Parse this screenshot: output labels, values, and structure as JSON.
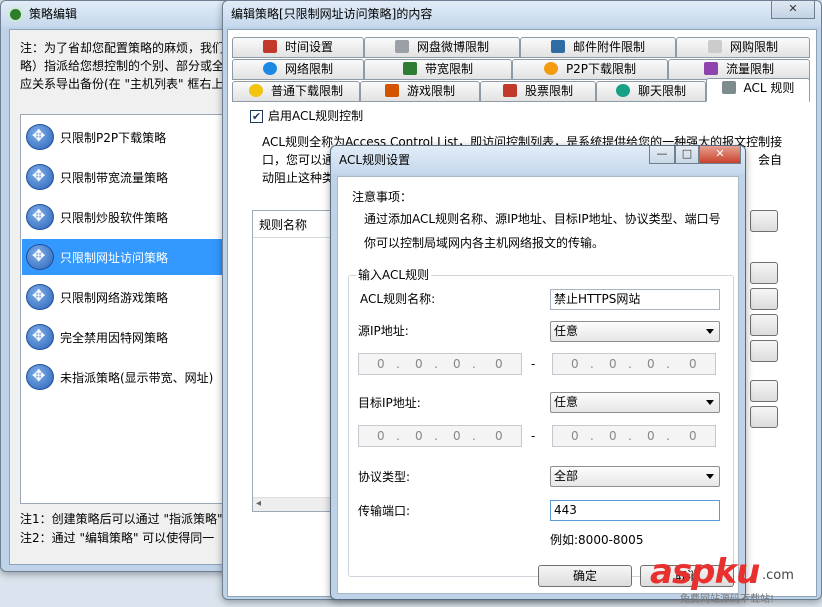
{
  "left_window": {
    "title": "策略编辑",
    "note_lines": [
      "注：为了省却您配置策略的麻烦，我们",
      "略）指派给您想控制的个别、部分或全",
      "应关系导出备份(在 \"主机列表\" 框右上"
    ],
    "items": [
      "只限制P2P下载策略",
      "只限制带宽流量策略",
      "只限制炒股软件策略",
      "只限制网址访问策略",
      "只限制网络游戏策略",
      "完全禁用因特网策略",
      "未指派策略(显示带宽、网址)"
    ],
    "selected_index": 3,
    "footer_lines": [
      "注1：创建策略后可以通过 \"指派策略\"",
      "注2：通过 \"编辑策略\" 可以使得同一"
    ]
  },
  "main_window": {
    "title": "编辑策略[只限制网址访问策略]的内容",
    "close_glyph": "✕",
    "tabs_row1": [
      {
        "label": "时间设置",
        "icon": "clock-icon",
        "color": "#c0392b"
      },
      {
        "label": "网盘微博限制",
        "icon": "cloud-icon",
        "color": "#9aa0a6"
      },
      {
        "label": "邮件附件限制",
        "icon": "mail-icon",
        "color": "#2e6da4"
      },
      {
        "label": "网购限制",
        "icon": "cart-icon",
        "color": "#cccccc"
      }
    ],
    "tabs_row2": [
      {
        "label": "网络限制",
        "icon": "ie-icon",
        "color": "#1e88e5"
      },
      {
        "label": "带宽限制",
        "icon": "bandwidth-icon",
        "color": "#2e7d32"
      },
      {
        "label": "P2P下载限制",
        "icon": "p2p-icon",
        "color": "#f39c12"
      },
      {
        "label": "流量限制",
        "icon": "traffic-icon",
        "color": "#8e44ad"
      }
    ],
    "tabs_row3": [
      {
        "label": "普通下载限制",
        "icon": "download-icon",
        "color": "#f1c40f"
      },
      {
        "label": "游戏限制",
        "icon": "game-icon",
        "color": "#d35400"
      },
      {
        "label": "股票限制",
        "icon": "stock-icon",
        "color": "#c0392b"
      },
      {
        "label": "聊天限制",
        "icon": "chat-icon",
        "color": "#16a085"
      },
      {
        "label": "ACL 规则",
        "icon": "acl-icon",
        "color": "#7f8c8d"
      }
    ],
    "enable_label": "启用ACL规则控制",
    "enable_checked": true,
    "desc_lines": [
      "ACL规则全称为Access Control List，即访问控制列表，是系统提供给您的一种强大的报文控制接",
      "口，您可以通",
      "动阻止这种类"
    ],
    "desc_right": "会自",
    "list_header": "规则名称",
    "side_buttons": [
      "",
      "",
      "",
      "",
      "",
      "",
      ""
    ],
    "scroll_left": "◂"
  },
  "dialog": {
    "title": "ACL规则设置",
    "notice_title": "注意事项：",
    "notice_lines": [
      "通过添加ACL规则名称、源IP地址、目标IP地址、协议类型、端口号",
      "你可以控制局域网内各主机网络报文的传输。"
    ],
    "group_title": "输入ACL规则",
    "rule_name_label": "ACL规则名称:",
    "rule_name_value": "禁止HTTPS网站",
    "src_ip_label": "源IP地址:",
    "src_ip_mode": "任意",
    "dst_ip_label": "目标IP地址:",
    "dst_ip_mode": "任意",
    "ip_octets": [
      "0",
      "0",
      "0",
      "0"
    ],
    "ip_dots": ".",
    "range_sep": "-",
    "protocol_label": "协议类型:",
    "protocol_value": "全部",
    "port_label": "传输端口:",
    "port_value": "443",
    "example": "例如:8000-8005",
    "ok_label": "确定",
    "cancel_label": "取消",
    "min_glyph": "—",
    "max_glyph": "□",
    "close_glyph": "✕"
  },
  "watermark": {
    "brand": "aspku",
    "tld": ".com",
    "tagline": "免费网站源码下载站!"
  }
}
